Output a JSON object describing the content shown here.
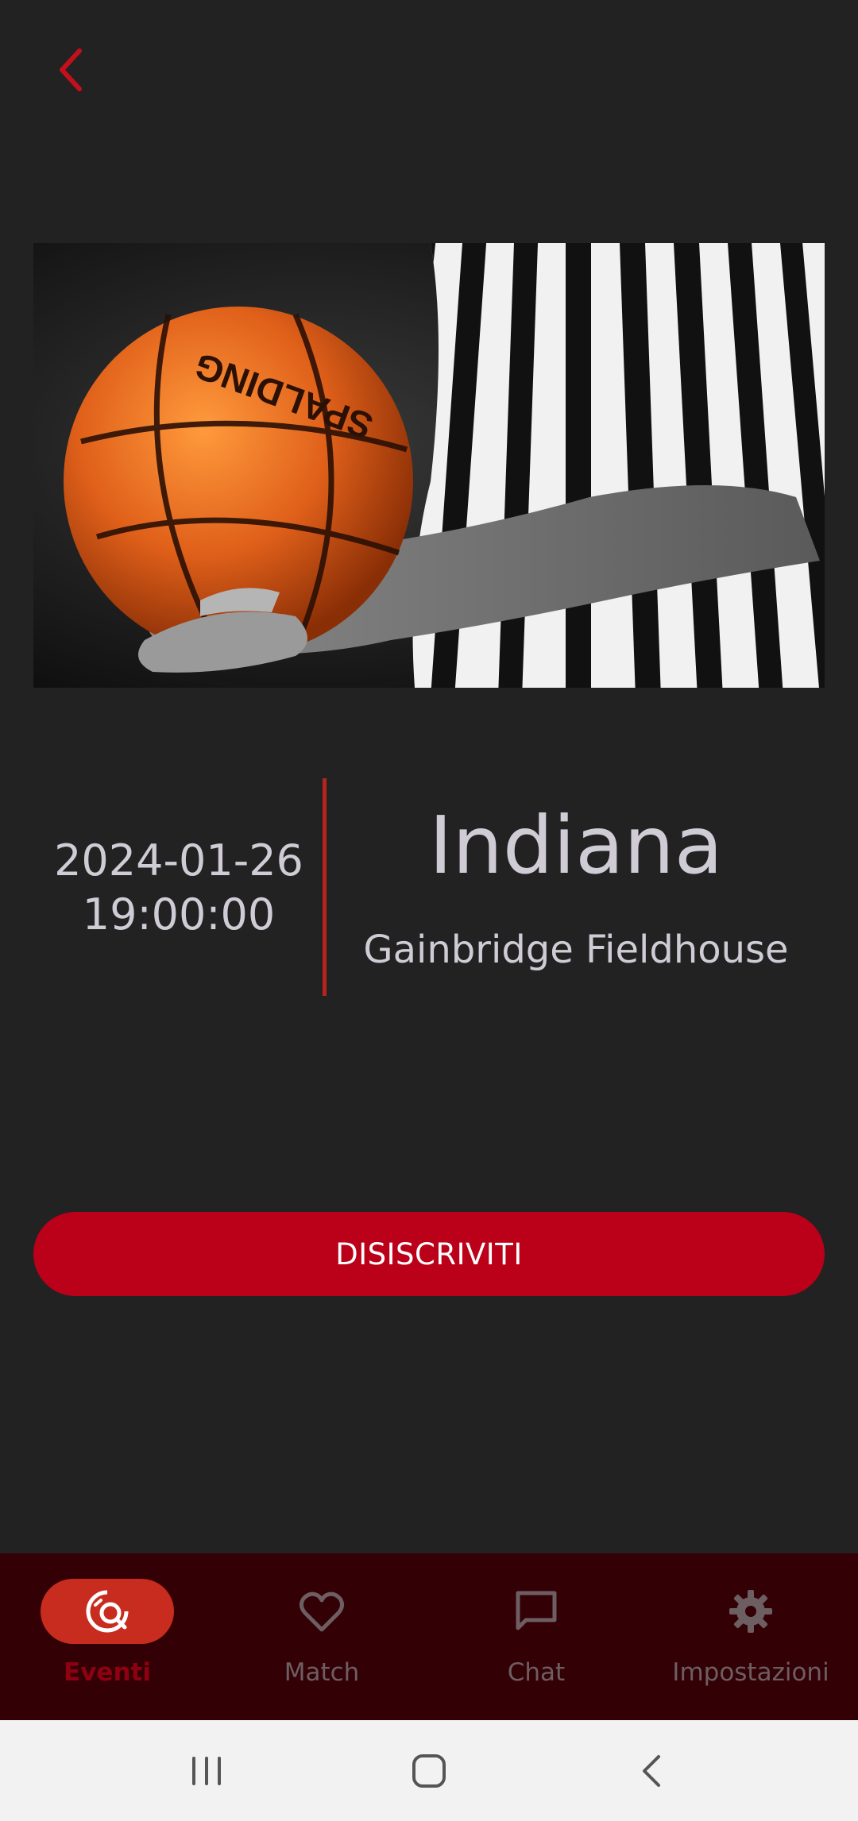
{
  "header": {
    "back_icon": "chevron-left-icon",
    "accent": "#c3101c"
  },
  "hero": {
    "image": "referee-holding-basketball"
  },
  "event": {
    "date": "2024-01-26",
    "time": "19:00:00",
    "team": "Indiana",
    "venue": "Gainbridge Fieldhouse"
  },
  "actions": {
    "unsubscribe_label": "DISISCRIVITI"
  },
  "bottom_nav": {
    "items": [
      {
        "label": "Eventi",
        "icon": "event-search-icon",
        "active": true
      },
      {
        "label": "Match",
        "icon": "heart-icon",
        "active": false
      },
      {
        "label": "Chat",
        "icon": "chat-bubble-icon",
        "active": false
      },
      {
        "label": "Impostazioni",
        "icon": "gear-icon",
        "active": false
      }
    ]
  },
  "system_nav": {
    "buttons": [
      "recents-icon",
      "home-icon",
      "system-back-icon"
    ]
  }
}
